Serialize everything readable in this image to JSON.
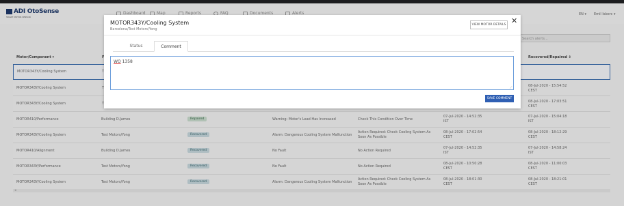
{
  "app": {
    "logo_text": "ADI OtoSense",
    "logo_sub": "SMART MOTOR SENSOR",
    "nav": [
      {
        "label": "Dashboard",
        "icon": "dashboard-icon"
      },
      {
        "label": "Map",
        "icon": "map-icon"
      },
      {
        "label": "Reports",
        "icon": "reports-icon"
      },
      {
        "label": "FAQ",
        "icon": "faq-icon"
      },
      {
        "label": "Documents",
        "icon": "documents-icon"
      },
      {
        "label": "Alerts",
        "icon": "alerts-icon"
      }
    ],
    "lang": "EN ▾",
    "user": "Emil Isberc ▾",
    "search_placeholder": "Search alerts...",
    "columns": [
      "Motor/Component ▾",
      "F",
      "Recovered/Repaired ⇕"
    ],
    "rows": [
      {
        "motor": "MOTOR343Y/Cooling System",
        "site": "T",
        "status": "",
        "status_type": "",
        "fault": "",
        "action": "",
        "date": "",
        "recovered": ""
      },
      {
        "motor": "MOTOR343Y/Cooling System",
        "site": "T",
        "status": "",
        "status_type": "",
        "fault": "",
        "action": "",
        "date": "",
        "recovered": "08-Jul-2020 - 15:54:52 CEST"
      },
      {
        "motor": "MOTOR343Y/Cooling System",
        "site": "T",
        "status": "",
        "status_type": "",
        "fault": "",
        "action": "",
        "date": "",
        "recovered": "08-Jul-2020 - 17:03:51 CEST"
      },
      {
        "motor": "MOTOR410/Performance",
        "site": "Building D.James",
        "status": "Repaired",
        "status_type": "repaired",
        "fault": "Warning: Motor's Load Has Increased",
        "action": "Check This Condition Over Time",
        "date": "07-Jul-2020 - 14:52:35 IST",
        "recovered": "07-Jul-2020 - 15:04:18 IST"
      },
      {
        "motor": "MOTOR343Y/Cooling System",
        "site": "Test Motors/Yong",
        "status": "Recovered",
        "status_type": "recovered",
        "fault": "Alarm: Dangerous Cooling System Malfunction",
        "action": "Action Required: Check Cooling System As Soon As Possible",
        "date": "08-Jul-2020 - 17:02:54 CEST",
        "recovered": "08-Jul-2020 - 18:12:29 CEST"
      },
      {
        "motor": "MOTOR410/Alignment",
        "site": "Building D.James",
        "status": "Recovered",
        "status_type": "recovered",
        "fault": "No Fault",
        "action": "No Action Required",
        "date": "07-Jul-2020 - 14:52:35 IST",
        "recovered": "07-Jul-2020 - 14:58:24 IST"
      },
      {
        "motor": "MOTOR343Y/Performance",
        "site": "Test Motors/Yong",
        "status": "Recovered",
        "status_type": "recovered",
        "fault": "No Fault",
        "action": "No Action Required",
        "date": "08-Jul-2020 - 10:50:28 CEST",
        "recovered": "08-Jul-2020 - 11:00:03 CEST"
      },
      {
        "motor": "MOTOR343Y/Cooling System",
        "site": "Test Motors/Yong",
        "status": "Recovered",
        "status_type": "recovered",
        "fault": "Alarm: Dangerous Cooling System Malfunction",
        "action": "Action Required: Check Cooling System As Soon As Possible",
        "date": "08-Jul-2020 - 18:01:30 CEST",
        "recovered": "08-Jul-2020 - 18:21:01 CEST"
      }
    ]
  },
  "modal": {
    "title": "MOTOR343Y/Cooling System",
    "subtitle": "Barcelona/Test Motors/Yong",
    "close": "✕",
    "view_details_label": "VIEW MOTOR DETAILS",
    "tabs": [
      {
        "label": "Status",
        "active": false
      },
      {
        "label": "Comment",
        "active": true
      }
    ],
    "comment_prefix": "WO",
    "comment_rest": " 1358",
    "save_label": "SAVE COMMENT"
  },
  "colors": {
    "accent": "#2f5fb3",
    "focus_border": "#6fa0dc",
    "logo": "#1f3a6b"
  }
}
